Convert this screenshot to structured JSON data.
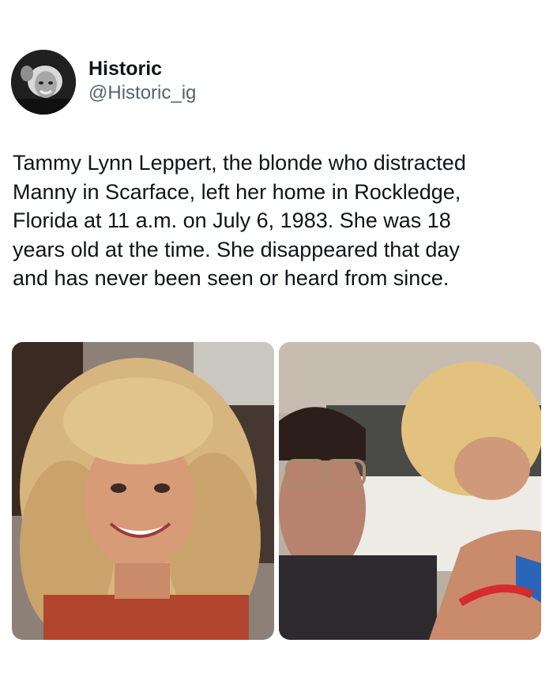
{
  "account": {
    "display_name": "Historic",
    "handle": "@Historic_ig",
    "avatar_icon": "profile-photo-icon"
  },
  "tweet": {
    "text": "Tammy Lynn Leppert, the blonde who distracted\nManny in Scarface, left her home in Rockledge,\nFlorida at 11 a.m. on July 6, 1983. She was 18\nyears old at the time. She disappeared that day\nand has never been seen or heard from since."
  },
  "media": {
    "left_icon": "portrait-photo-icon",
    "right_icon": "movie-still-photo-icon"
  }
}
